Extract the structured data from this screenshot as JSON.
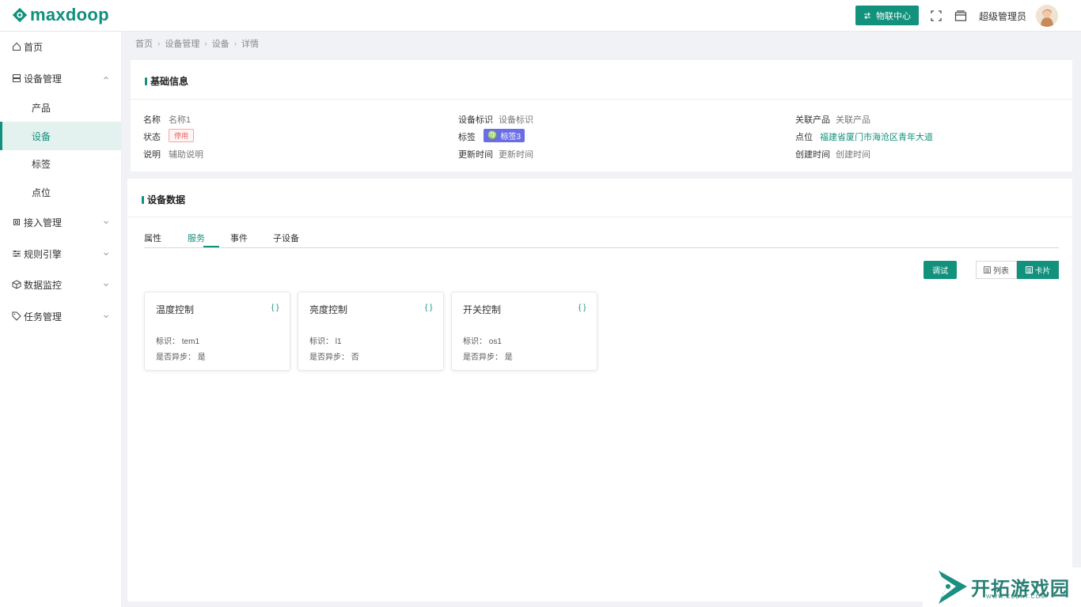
{
  "header": {
    "logo_text": "maxdoop",
    "iot_button": "物联中心",
    "admin_name": "超级管理员"
  },
  "sidebar": {
    "items": [
      {
        "label": "首页"
      },
      {
        "label": "设备管理"
      },
      {
        "label": "产品"
      },
      {
        "label": "设备"
      },
      {
        "label": "标签"
      },
      {
        "label": "点位"
      },
      {
        "label": "接入管理"
      },
      {
        "label": "规则引擎"
      },
      {
        "label": "数据监控"
      },
      {
        "label": "任务管理"
      }
    ]
  },
  "breadcrumb": [
    "首页",
    "设备管理",
    "设备",
    "详情"
  ],
  "basic_info": {
    "title": "基础信息",
    "name_label": "名称",
    "name_value": "名称1",
    "device_id_label": "设备标识",
    "device_id_value": "设备标识",
    "product_label": "关联产品",
    "product_value": "关联产品",
    "status_label": "状态",
    "status_value": "停用",
    "tag_label": "标签",
    "tag_value": "标签3",
    "point_label": "点位",
    "point_value": "福建省厦门市海沧区青年大道",
    "desc_label": "说明",
    "desc_value": "辅助说明",
    "updated_label": "更新时间",
    "updated_value": "更新时间",
    "created_label": "创建时间",
    "created_value": "创建时间"
  },
  "device_data": {
    "title": "设备数据",
    "tabs": [
      "属性",
      "服务",
      "事件",
      "子设备"
    ],
    "active_tab": "服务",
    "debug_button": "调试",
    "view_list": "列表",
    "view_card": "卡片",
    "cards": [
      {
        "title": "温度控制",
        "brace": "{ }",
        "id_label": "标识：",
        "id_value": "tem1",
        "async_label": "是否异步：",
        "async_value": "是"
      },
      {
        "title": "亮度控制",
        "brace": "{ }",
        "id_label": "标识：",
        "id_value": "l1",
        "async_label": "是否异步：",
        "async_value": "否"
      },
      {
        "title": "开关控制",
        "brace": "{ }",
        "id_label": "标识：",
        "id_value": "os1",
        "async_label": "是否异步：",
        "async_value": "是"
      }
    ]
  },
  "watermark": {
    "title": "开拓游戏园",
    "url": "WWW.CDDKT.COM"
  },
  "colors": {
    "accent": "#12917d",
    "tag_purple": "#6a6ee6",
    "danger": "#e86161"
  }
}
